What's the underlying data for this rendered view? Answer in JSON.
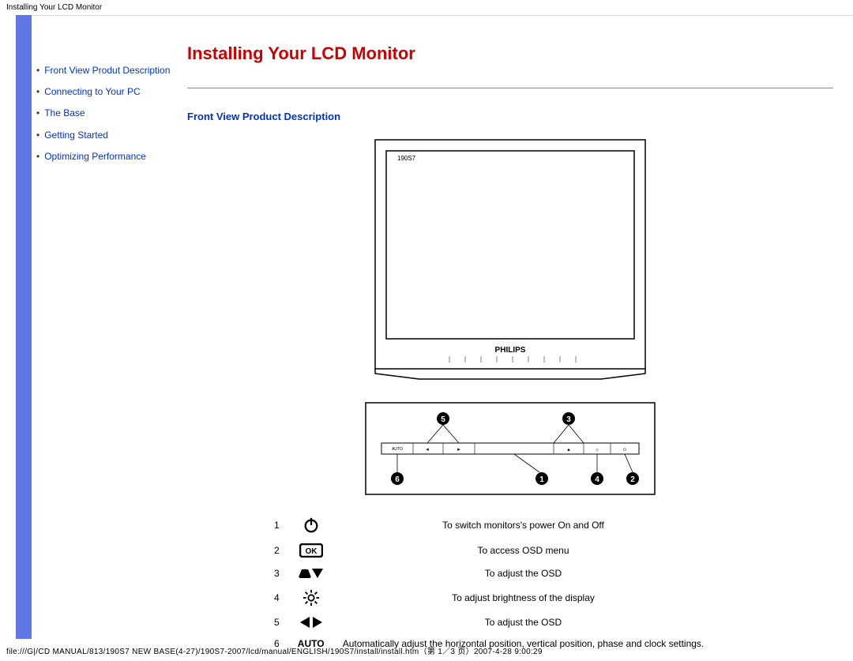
{
  "header": {
    "title": "Installing Your LCD Monitor"
  },
  "sidebar": {
    "items": [
      {
        "text": "Front View Produt Description"
      },
      {
        "text": "Connecting to Your PC"
      },
      {
        "text": "The Base"
      },
      {
        "text": "Getting Started"
      },
      {
        "text": "Optimizing Performance"
      }
    ]
  },
  "main": {
    "page_title": "Installing Your LCD Monitor",
    "section_heading": "Front View Product Description",
    "monitor_brand": "PHILIPS",
    "panel_auto_label": "AUTO",
    "legend": [
      {
        "num": "1",
        "icon": "power",
        "desc": "To switch monitors's power On and Off"
      },
      {
        "num": "2",
        "icon": "ok",
        "desc": "To access OSD menu"
      },
      {
        "num": "3",
        "icon": "updown",
        "desc": "To adjust the OSD"
      },
      {
        "num": "4",
        "icon": "brightness",
        "desc": "To adjust brightness of the display"
      },
      {
        "num": "5",
        "icon": "leftright",
        "desc": "To adjust the OSD"
      },
      {
        "num": "6",
        "icon": "auto",
        "desc": "Automatically adjust the horizontal position, vertical position, phase and clock settings."
      }
    ]
  },
  "footer": {
    "text": "file:///G|/CD MANUAL/813/190S7 NEW BASE(4-27)/190S7-2007/lcd/manual/ENGLISH/190S7/install/install.htm（第 1／3 页）2007-4-28 9:00:29"
  }
}
